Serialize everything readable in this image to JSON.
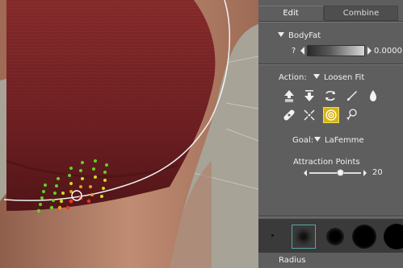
{
  "tabs": {
    "edit": "Edit",
    "combine": "Combine"
  },
  "morph": {
    "name": "BodyFat",
    "help": "?",
    "value": "0.0000"
  },
  "action": {
    "label": "Action:",
    "value": "Loosen Fit"
  },
  "tools": {
    "row1": [
      "push-up-icon",
      "push-down-icon",
      "loop-icon",
      "brush-icon",
      "drop-icon"
    ],
    "row2": [
      "bandage-icon",
      "spread-icon",
      "attract-icon",
      "pin-icon"
    ],
    "selected": "attract-icon"
  },
  "goal": {
    "label": "Goal:",
    "value": "LaFemme"
  },
  "attraction": {
    "label": "Attraction Points",
    "value": "20",
    "level": 0.6
  },
  "brushes": {
    "label": "Radius",
    "selected_index": 1
  },
  "colors": {
    "selected_tool": "#d8b413",
    "garment": "#7a2426",
    "skin": "#b98268"
  }
}
